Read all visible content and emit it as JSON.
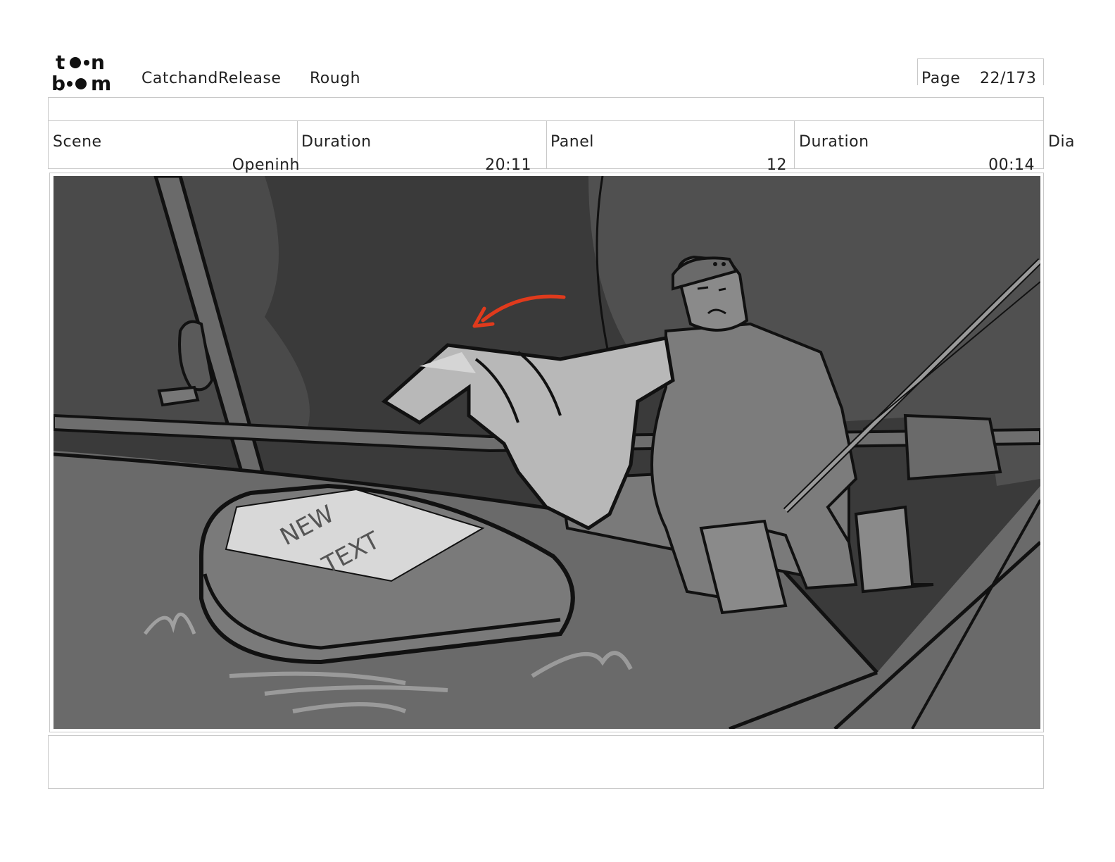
{
  "header": {
    "logo_text": "toon boom",
    "project_name": "CatchandRelease",
    "stage": "Rough",
    "page_label": "Page",
    "page_value": "22/173"
  },
  "info": {
    "scene_label": "Scene",
    "scene_value": "Openinh",
    "scene_duration_label": "Duration",
    "scene_duration_value": "20:11",
    "panel_label": "Panel",
    "panel_value": "12",
    "panel_duration_label": "Duration",
    "panel_duration_value": "00:14",
    "dialogue_label": "Dia"
  },
  "panel_art": {
    "description_text_on_object": "NEW TEXT",
    "arrow_color": "#e03a1c",
    "palette": [
      "#333333",
      "#555555",
      "#6e6e6e",
      "#8a8a8a",
      "#b5b5b5",
      "#d8d8d8"
    ]
  }
}
